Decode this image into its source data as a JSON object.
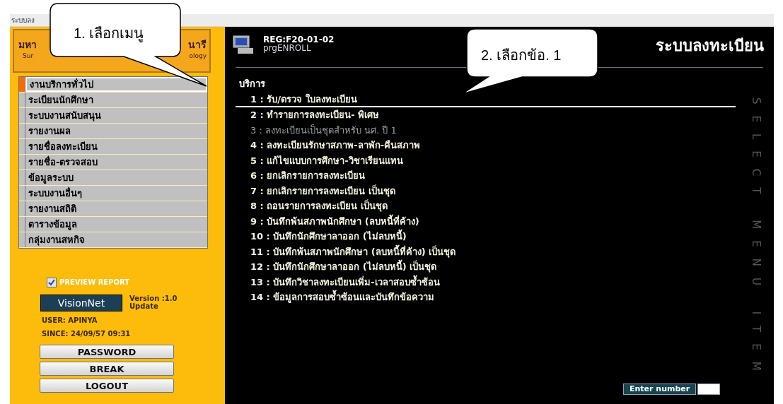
{
  "window": {
    "title": "ระบบลง"
  },
  "logo": {
    "line_1_left": "มหา",
    "line_1_right": "นารี",
    "line_2_left": "Sur",
    "line_2_right": "ology"
  },
  "sidebar": {
    "items": [
      {
        "label": "งานบริการทั่วไป",
        "selected": true
      },
      {
        "label": "ระเบียนนักศึกษา",
        "selected": false
      },
      {
        "label": "ระบบงานสนับสนุน",
        "selected": false
      },
      {
        "label": "รายงานผล",
        "selected": false
      },
      {
        "label": "รายชื่อลงทะเบียน",
        "selected": false
      },
      {
        "label": "รายชื่อ-ตรวจสอบ",
        "selected": false
      },
      {
        "label": "ข้อมูลระบบ",
        "selected": false
      },
      {
        "label": "ระบบงานอื่นๆ",
        "selected": false
      },
      {
        "label": "รายงานสถิติ",
        "selected": false
      },
      {
        "label": "ตารางข้อมูล",
        "selected": false
      },
      {
        "label": "กลุ่มงานสหกิจ",
        "selected": false
      }
    ]
  },
  "preview_report": {
    "label": "PREVIEW REPORT",
    "checked": true
  },
  "brand": {
    "logo_text": "VisionNet",
    "version": "Version :1.0",
    "update": "Update"
  },
  "user": "USER: APINYA",
  "since": "SINCE: 24/09/57 09:31",
  "buttons": [
    "PASSWORD",
    "BREAK",
    "LOGOUT"
  ],
  "header": {
    "code": "REG:F20-01-02",
    "program": "prgENROLL",
    "title": "ระบบลงทะเบียน"
  },
  "section_title": "บริการ",
  "menu": [
    {
      "label": "1 : รับ/ตรวจ ใบลงทะเบียน",
      "selected": true,
      "disabled": false
    },
    {
      "label": "2 : ทำรายการลงทะเบียน- พิเศษ",
      "selected": false,
      "disabled": false
    },
    {
      "label": "3 : ลงทะเบียนเป็นชุดสำหรับ นศ. ปี 1",
      "selected": false,
      "disabled": true
    },
    {
      "label": "4 : ลงทะเบียนรักษาสภาพ-ลาพัก-คืนสภาพ",
      "selected": false,
      "disabled": false
    },
    {
      "label": "5 : แก้ไขแบบการศึกษา-วิชาเรียนแทน",
      "selected": false,
      "disabled": false
    },
    {
      "label": "6 : ยกเลิกรายการลงทะเบียน",
      "selected": false,
      "disabled": false
    },
    {
      "label": "7 : ยกเลิกรายการลงทะเบียน เป็นชุด",
      "selected": false,
      "disabled": false
    },
    {
      "label": "8 : ถอนรายการลงทะเบียน เป็นชุด",
      "selected": false,
      "disabled": false
    },
    {
      "label": "9 : บันทึกพ้นสภาพนักศึกษา (ลบหนี้ที่ค้าง)",
      "selected": false,
      "disabled": false
    },
    {
      "label": "10 : บันทึกนักศึกษาลาออก (ไม่ลบหนี้)",
      "selected": false,
      "disabled": false
    },
    {
      "label": "11 : บันทึกพ้นสภาพนักศึกษา (ลบหนี้ที่ค้าง) เป็นชุด",
      "selected": false,
      "disabled": false
    },
    {
      "label": "12 : บันทึกนักศึกษาลาออก (ไม่ลบหนี้) เป็นชุด",
      "selected": false,
      "disabled": false
    },
    {
      "label": "13 : บันทึกวิชาลงทะเบียนเพิ่ม-เวลาสอบซ้ำซ้อน",
      "selected": false,
      "disabled": false
    },
    {
      "label": "14 : ข้อมูลการสอบซ้ำซ้อนและบันทึกข้อความ",
      "selected": false,
      "disabled": false
    }
  ],
  "side_caption": "SELECT MENU ITEM",
  "enter_number": {
    "label": "Enter number"
  },
  "callouts": [
    {
      "text": "1. เลือกเมนู"
    },
    {
      "text": "2. เลือกข้อ. 1"
    }
  ]
}
